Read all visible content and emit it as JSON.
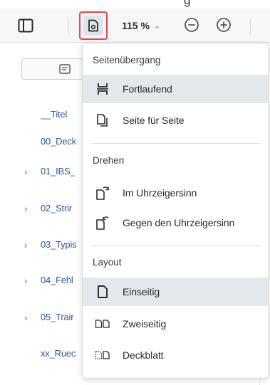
{
  "header": {
    "caption_fragment": "g"
  },
  "toolbar": {
    "zoom_label": "115 %",
    "zoom_chevron": "⌄"
  },
  "sidebar": {
    "items": [
      {
        "label": "__Titel",
        "expandable": false
      },
      {
        "label": "00_Deck",
        "expandable": false
      },
      {
        "label": "01_IBS_",
        "expandable": true
      },
      {
        "label": "02_Strir",
        "expandable": true
      },
      {
        "label": "03_Typis",
        "expandable": true
      },
      {
        "label": "04_Fehl",
        "expandable": true
      },
      {
        "label": "05_Trair",
        "expandable": true
      },
      {
        "label": "xx_Ruec",
        "expandable": false
      }
    ],
    "chevron": "›"
  },
  "menu": {
    "section_transition": "Seitenübergang",
    "continuous": "Fortlaufend",
    "page_by_page": "Seite für Seite",
    "section_rotate": "Drehen",
    "rotate_cw": "Im Uhrzeigersinn",
    "rotate_ccw": "Gegen den Uhrzeigersinn",
    "section_layout": "Layout",
    "single": "Einseitig",
    "double": "Zweiseitig",
    "cover": "Deckblatt",
    "active_items": [
      "continuous",
      "single"
    ]
  },
  "colors": {
    "accent_highlight": "#e8474c",
    "link": "#2e57a6",
    "active_bg": "#e4e7ec"
  }
}
